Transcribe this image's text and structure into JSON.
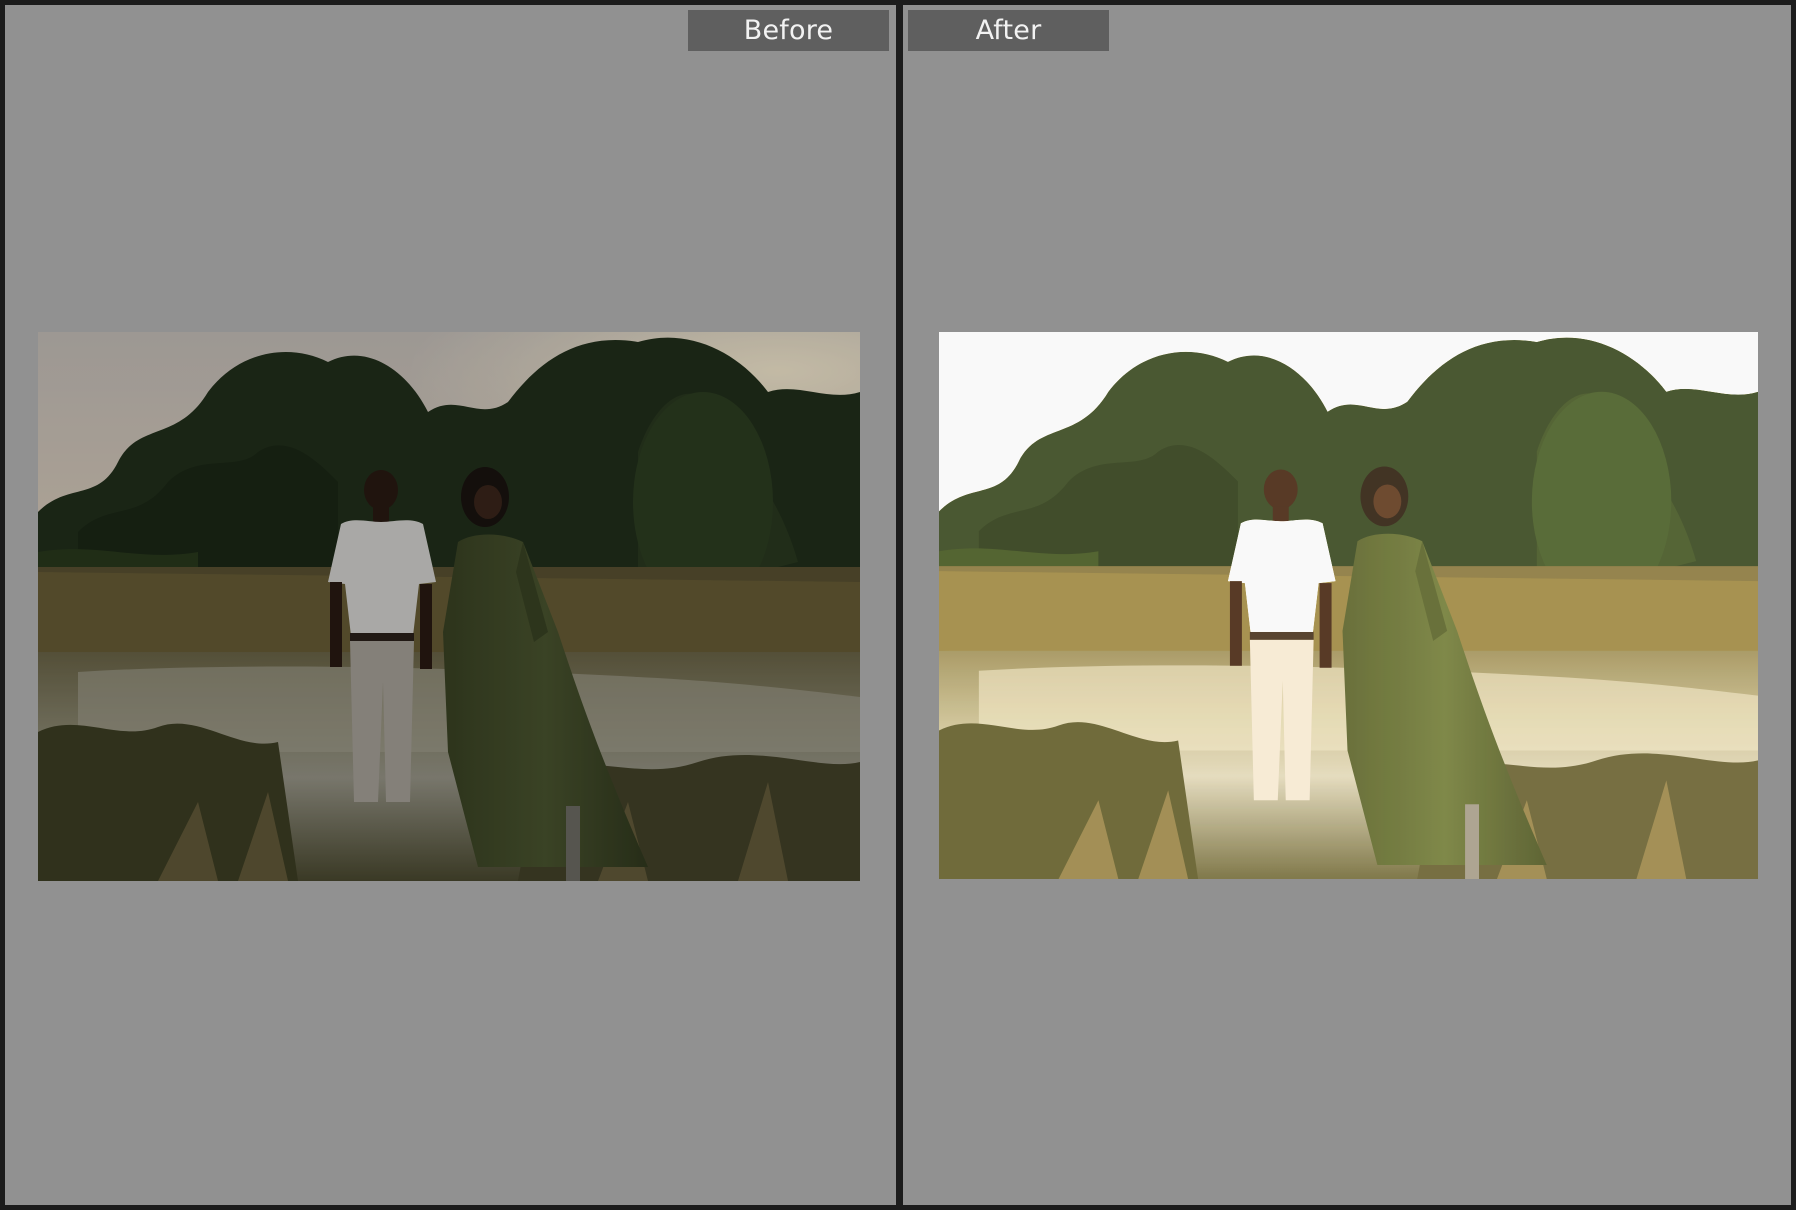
{
  "compare": {
    "before": {
      "label": "Before"
    },
    "after": {
      "label": "After"
    }
  },
  "colors": {
    "pane_background": "#919191",
    "label_background": "#5f5f5f",
    "label_text": "#f2f2f2",
    "divider": "#1c1c1c"
  }
}
